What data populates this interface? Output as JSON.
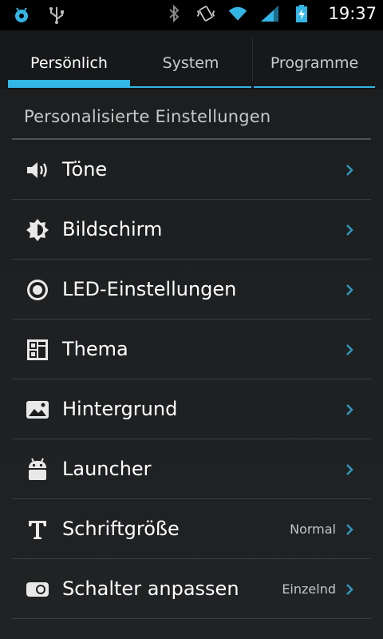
{
  "statusbar": {
    "time": "19:37",
    "left_icons": [
      "android-debug-icon",
      "usb-icon"
    ],
    "right_icons": [
      "bluetooth-icon",
      "vibrate-icon",
      "wifi-icon",
      "signal-icon",
      "battery-charging-icon"
    ]
  },
  "tabs": [
    {
      "label": "Persönlich",
      "active": true
    },
    {
      "label": "System",
      "active": false
    },
    {
      "label": "Programme",
      "active": false
    }
  ],
  "section": {
    "title": "Personalisierte Einstellungen"
  },
  "items": [
    {
      "label": "Töne",
      "icon": "speaker-icon",
      "value": ""
    },
    {
      "label": "Bildschirm",
      "icon": "brightness-icon",
      "value": ""
    },
    {
      "label": "LED-Einstellungen",
      "icon": "led-icon",
      "value": ""
    },
    {
      "label": "Thema",
      "icon": "theme-icon",
      "value": ""
    },
    {
      "label": "Hintergrund",
      "icon": "wallpaper-icon",
      "value": ""
    },
    {
      "label": "Launcher",
      "icon": "android-icon",
      "value": ""
    },
    {
      "label": "Schriftgröße",
      "icon": "font-icon",
      "value": "Normal"
    },
    {
      "label": "Schalter anpassen",
      "icon": "toggle-icon",
      "value": "Einzelnd"
    }
  ],
  "colors": {
    "accent": "#33b5e5",
    "background": "#1c1e20",
    "statusbar": "#000000"
  }
}
